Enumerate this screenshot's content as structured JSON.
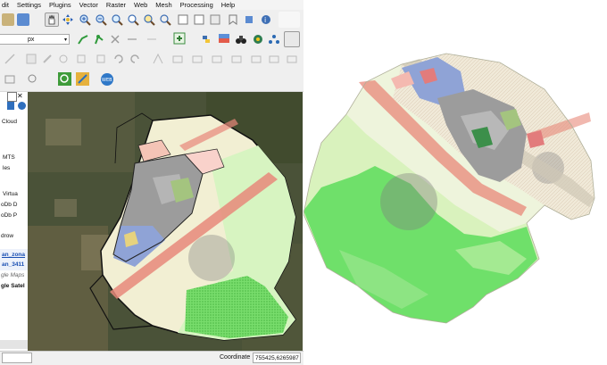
{
  "menu": [
    "dit",
    "Settings",
    "Plugins",
    "Vector",
    "Raster",
    "Web",
    "Mesh",
    "Processing",
    "Help"
  ],
  "toolbar": {
    "unit_combo": "px"
  },
  "layers_panel": {
    "items": [
      "Cloud",
      "MTS",
      "les",
      "Virtua",
      "oDb D",
      "oDb P",
      "drow",
      "an_zona",
      "an_3411",
      "gle Maps",
      "gle Satel"
    ]
  },
  "status": {
    "coordinate_label": "Coordinate",
    "coordinate_value": "755425,6265987"
  },
  "colors": {
    "satellite_dark": "#3f4a33",
    "boundary": "#111111",
    "green_zone": "#6fe06a",
    "light_green": "#d9f5c0",
    "pale_yellow": "#f3f0d6",
    "urban_blue": "#8fa3d6",
    "urban_gray": "#9c9c9c",
    "road_red": "#e8887a",
    "selected_layer_bg": "#3b6fd1"
  },
  "icons": [
    "pan-icon",
    "zoom-in-icon",
    "zoom-out-icon",
    "identify-icon",
    "select-icon",
    "python-icon",
    "processing-icon",
    "save-icon",
    "digitize-icon",
    "undo-icon",
    "redo-icon",
    "snap-icon",
    "web-icon"
  ]
}
